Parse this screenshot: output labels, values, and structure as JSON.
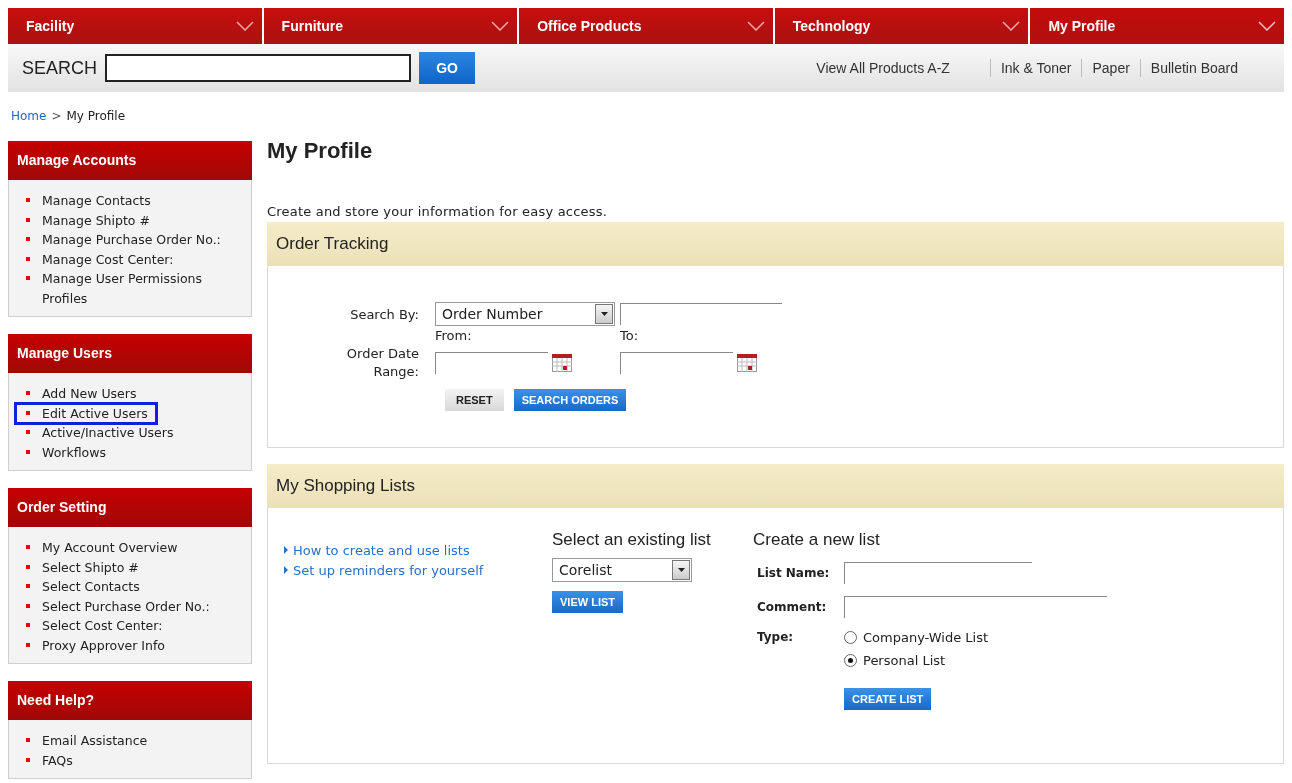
{
  "nav": {
    "tabs": [
      {
        "label": "Facility",
        "selected": false
      },
      {
        "label": "Furniture",
        "selected": false
      },
      {
        "label": "Office Products",
        "selected": false
      },
      {
        "label": "Technology",
        "selected": false
      },
      {
        "label": "My Profile",
        "selected": true
      }
    ]
  },
  "search": {
    "label": "SEARCH",
    "button": "GO",
    "links": [
      "View All Products A-Z",
      "Ink & Toner",
      "Paper",
      "Bulletin Board"
    ]
  },
  "breadcrumb": [
    {
      "label": "Home",
      "link": true,
      "separator": ">"
    },
    {
      "label": "My Profile",
      "link": false
    }
  ],
  "sidebar": [
    {
      "title": "Manage Accounts",
      "items": [
        {
          "label": "Manage Contacts",
          "highlighted": false
        },
        {
          "label": "Manage Shipto #",
          "highlighted": false
        },
        {
          "label": "Manage Purchase Order No.:",
          "highlighted": false
        },
        {
          "label": "Manage Cost Center:",
          "highlighted": false
        },
        {
          "label": "Manage User Permissions Profiles",
          "highlighted": false
        }
      ]
    },
    {
      "title": "Manage Users",
      "items": [
        {
          "label": "Add New Users",
          "highlighted": false
        },
        {
          "label": "Edit Active Users",
          "highlighted": true
        },
        {
          "label": "Active/Inactive Users",
          "highlighted": false
        },
        {
          "label": "Workflows",
          "highlighted": false
        }
      ]
    },
    {
      "title": "Order Setting",
      "items": [
        {
          "label": "My Account Overview",
          "highlighted": false
        },
        {
          "label": "Select Shipto #",
          "highlighted": false
        },
        {
          "label": "Select Contacts",
          "highlighted": false
        },
        {
          "label": "Select Purchase Order No.:",
          "highlighted": false
        },
        {
          "label": "Select Cost Center:",
          "highlighted": false
        },
        {
          "label": "Proxy Approver Info",
          "highlighted": false
        }
      ]
    },
    {
      "title": "Need Help?",
      "items": [
        {
          "label": "Email Assistance",
          "highlighted": false
        },
        {
          "label": "FAQs",
          "highlighted": false
        }
      ]
    }
  ],
  "main": {
    "title": "My Profile",
    "intro": "Create and store your information for easy access.",
    "order_tracking": {
      "title": "Order Tracking",
      "search_by_label": "Search By:",
      "search_by_value": "Order Number",
      "date_label": "Order Date Range:",
      "from_label": "From:",
      "to_label": "To:",
      "reset": "RESET",
      "submit": "SEARCH ORDERS"
    },
    "shopping_lists": {
      "title": "My Shopping Lists",
      "help_links": [
        "How to create and use lists",
        "Set up reminders for yourself"
      ],
      "existing": {
        "title": "Select an existing list",
        "value": "Corelist",
        "button": "VIEW LIST"
      },
      "create": {
        "title": "Create a new list",
        "name_label": "List Name:",
        "comment_label": "Comment:",
        "type_label": "Type:",
        "types": [
          {
            "label": "Company-Wide List",
            "selected": false
          },
          {
            "label": "Personal List",
            "selected": true
          }
        ],
        "button": "CREATE LIST"
      }
    }
  }
}
